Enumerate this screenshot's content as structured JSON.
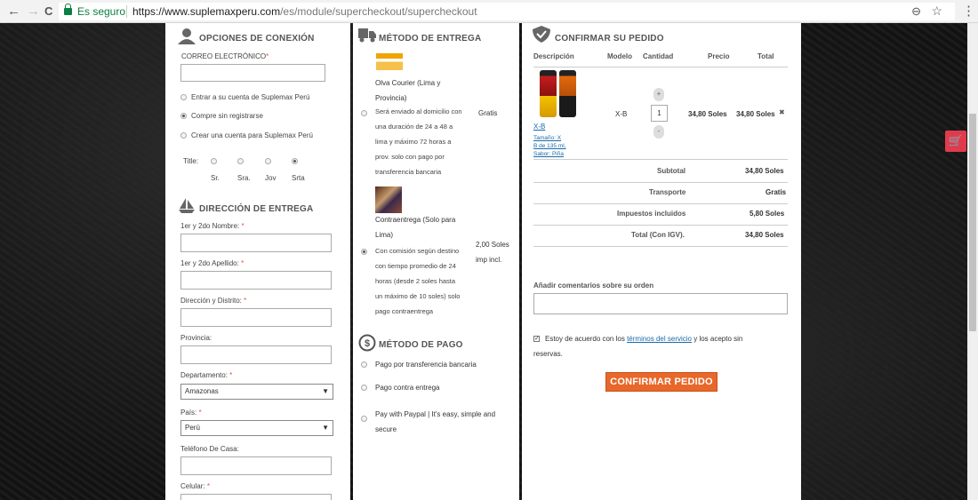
{
  "browser": {
    "secure_label": "Es seguro",
    "url_host": "https://www.suplemaxperu.com",
    "url_path": "/es/module/supercheckout/supercheckout",
    "back": "←",
    "forward": "→",
    "reload": "C",
    "zoom": "⊖",
    "star": "☆",
    "menu": "⋮"
  },
  "login": {
    "title": "OPCIONES DE CONEXIÓN",
    "email_label": "CORREO ELECTRÓNICO",
    "req": "*",
    "options": [
      "Entrar a su cuenta de Suplemax Perú",
      "Compre sin registrarse",
      "Crear una cuenta para Suplemax Perú"
    ],
    "title_label": "Title:",
    "titles": [
      "Sr.",
      "Sra.",
      "Jov",
      "Srta"
    ]
  },
  "address": {
    "title": "DIRECCIÓN DE ENTREGA",
    "req": "*",
    "fields": [
      "1er y 2do Nombre:",
      "1er y 2do Apellido:",
      "Dirección y Distrito:",
      "Provincia:",
      "Departamento:",
      "País:",
      "Teléfono De Casa:",
      "Celular:"
    ],
    "department": "Amazonas",
    "country": "Perú",
    "arrow": "▼"
  },
  "delivery": {
    "title": "MÉTODO DE ENTREGA",
    "opt1": {
      "name": [
        "Olva Courier (Lima y",
        "Provincia)"
      ],
      "desc": [
        "Será enviado al domicilio con",
        "una duración de 24 a 48 a",
        "lima y máximo 72 horas a",
        "prov. solo con pago por",
        "transferencia bancaria"
      ],
      "price": "Gratis"
    },
    "opt2": {
      "name": [
        "Contraentrega (Solo para",
        "Lima)"
      ],
      "desc": [
        "Con comisión según destino",
        "con tiempo promedio de 24",
        "horas (desde 2 soles hasta",
        "un máximo de 10 soles) solo",
        "pago contraentrega"
      ],
      "price": [
        "2,00 Soles",
        "imp incl."
      ]
    }
  },
  "payment": {
    "title": "MÉTODO DE PAGO",
    "options": [
      "Pago por transferencia bancaria",
      "Pago contra entrega"
    ],
    "paypal": [
      "Pay with Paypal | It's easy, simple and",
      "secure"
    ]
  },
  "order": {
    "title": "CONFIRMAR SU PEDIDO",
    "headers": [
      "Descripción",
      "Modelo",
      "Cantidad",
      "Precio",
      "Total"
    ],
    "item": {
      "name": "X-B",
      "attrs": [
        "Tamaño: X",
        "B de 135 ml,",
        "Sabor: Piña"
      ],
      "model": "X-B",
      "qty": "1",
      "price": "34,80 Soles",
      "total": "34,80 Soles",
      "plus": "+",
      "minus": "-",
      "remove": "✖"
    },
    "summary": [
      {
        "label": "Subtotal",
        "value": "34,80 Soles"
      },
      {
        "label": "Transporte",
        "value": "Gratis"
      },
      {
        "label": "Impuestos incluidos",
        "value": "5,80 Soles"
      },
      {
        "label": "Total (Con IGV).",
        "value": "34,80 Soles"
      }
    ],
    "comments_label": "Añadir comentarios sobre su orden",
    "terms": {
      "pre": "Estoy de acuerdo con los",
      "link": "términos del servicio",
      "post": "y los acepto sin",
      "line2": "reservas."
    },
    "confirm": "CONFIRMAR PEDIDO"
  },
  "side": {
    "cart_icon": "🛒"
  }
}
